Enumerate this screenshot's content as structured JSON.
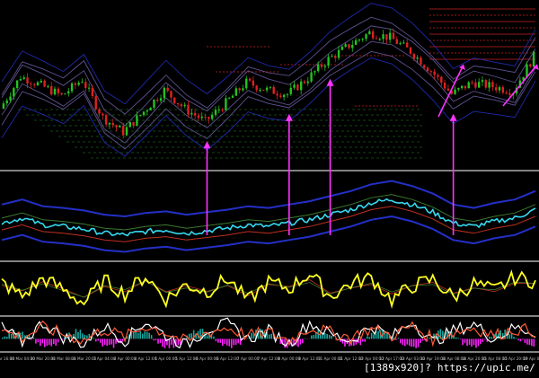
{
  "watermark": "[1389x920]? https://upic.me/",
  "colors": {
    "background": "#000000",
    "separator": "#cfcfcf",
    "candle_up": "#22c322",
    "candle_down": "#dd2222",
    "arrow": "#ff33ff",
    "band_outer": "#2430c8",
    "band_inner": "#6f5fa8",
    "ma_red": "#c03020",
    "ma_green": "#3c7a30",
    "price_line": "#36d9f0",
    "osc_yellow": "#ffff22",
    "stoch_white": "#ffffff",
    "stoch_red": "#ff5a36",
    "hist_magenta": "#ff22ff",
    "hist_teal": "#1aa8a0",
    "level_red": "#cc2222",
    "level_green": "#2b8a2b"
  },
  "chart_data": [
    {
      "type": "candlestick",
      "panel": "price",
      "x": [
        "29 Mar 16:00",
        "30 Mar 04:00",
        "30 Mar 20:00",
        "31 Mar 08:00",
        "31 Mar 20:00",
        "1 Apr 04:00",
        "4 Apr 00:00",
        "4 Apr 12:00",
        "5 Apr 00:00",
        "5 Apr 12:00",
        "6 Apr 00:00",
        "6 Apr 12:00",
        "7 Apr 00:00",
        "7 Apr 12:00",
        "8 Apr 00:00",
        "8 Apr 12:00",
        "11 Apr 00:00",
        "11 Apr 12:00",
        "12 Apr 00:00",
        "12 Apr 17:00",
        "13 Apr 03:00",
        "13 Apr 19:00",
        "14 Apr 08:00",
        "14 Apr 20:00",
        "15 Apr 08:00",
        "15 Apr 20:00",
        "19 Apr 00:00"
      ],
      "close": [
        1.134,
        1.1395,
        1.138,
        1.1362,
        1.139,
        1.1325,
        1.13,
        1.1335,
        1.1372,
        1.134,
        1.1318,
        1.135,
        1.1385,
        1.1372,
        1.1365,
        1.1392,
        1.1425,
        1.1448,
        1.147,
        1.1462,
        1.1438,
        1.1405,
        1.1365,
        1.1385,
        1.1378,
        1.137,
        1.143
      ],
      "signals": [
        {
          "x": "6 Apr 00:00",
          "direction": "up"
        },
        {
          "x": "8 Apr 00:00",
          "direction": "up"
        },
        {
          "x": "11 Apr 00:00",
          "direction": "up"
        },
        {
          "x": "14 Apr 08:00",
          "direction": "up"
        }
      ]
    },
    {
      "type": "line",
      "panel": "indicator_1",
      "series": [
        {
          "values": [
            0.42,
            0.48,
            0.4,
            0.38,
            0.35,
            0.3,
            0.28,
            0.32,
            0.34,
            0.3,
            0.33,
            0.36,
            0.4,
            0.38,
            0.42,
            0.46,
            0.52,
            0.58,
            0.66,
            0.7,
            0.64,
            0.55,
            0.42,
            0.38,
            0.44,
            0.48,
            0.58
          ]
        }
      ]
    },
    {
      "type": "line",
      "panel": "indicator_2",
      "series": [
        {
          "values": [
            62,
            35,
            70,
            48,
            22,
            66,
            40,
            75,
            30,
            58,
            44,
            70,
            26,
            63,
            50,
            80,
            35,
            60,
            72,
            28,
            55,
            68,
            33,
            60,
            46,
            72,
            64
          ]
        }
      ]
    },
    {
      "type": "line",
      "panel": "stochastic",
      "series": [
        {
          "values": [
            70,
            25,
            85,
            40,
            20,
            75,
            30,
            90,
            45,
            15,
            65,
            80,
            35,
            60,
            20,
            85,
            50,
            30,
            75,
            40,
            90,
            25,
            60,
            80,
            35,
            70,
            55
          ]
        },
        {
          "values": [
            60,
            40,
            70,
            50,
            30,
            65,
            40,
            75,
            55,
            25,
            55,
            70,
            45,
            55,
            30,
            70,
            55,
            40,
            65,
            45,
            75,
            35,
            55,
            70,
            45,
            65,
            60
          ]
        }
      ]
    }
  ]
}
